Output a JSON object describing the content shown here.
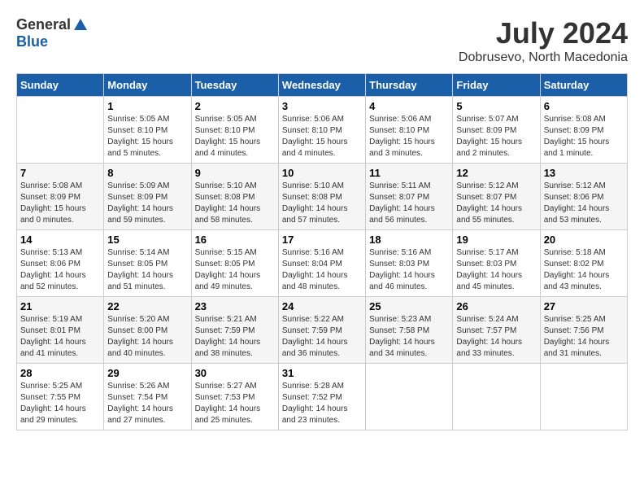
{
  "logo": {
    "general": "General",
    "blue": "Blue"
  },
  "title": {
    "month": "July 2024",
    "location": "Dobrusevo, North Macedonia"
  },
  "headers": [
    "Sunday",
    "Monday",
    "Tuesday",
    "Wednesday",
    "Thursday",
    "Friday",
    "Saturday"
  ],
  "weeks": [
    [
      {
        "day": "",
        "info": ""
      },
      {
        "day": "1",
        "info": "Sunrise: 5:05 AM\nSunset: 8:10 PM\nDaylight: 15 hours\nand 5 minutes."
      },
      {
        "day": "2",
        "info": "Sunrise: 5:05 AM\nSunset: 8:10 PM\nDaylight: 15 hours\nand 4 minutes."
      },
      {
        "day": "3",
        "info": "Sunrise: 5:06 AM\nSunset: 8:10 PM\nDaylight: 15 hours\nand 4 minutes."
      },
      {
        "day": "4",
        "info": "Sunrise: 5:06 AM\nSunset: 8:10 PM\nDaylight: 15 hours\nand 3 minutes."
      },
      {
        "day": "5",
        "info": "Sunrise: 5:07 AM\nSunset: 8:09 PM\nDaylight: 15 hours\nand 2 minutes."
      },
      {
        "day": "6",
        "info": "Sunrise: 5:08 AM\nSunset: 8:09 PM\nDaylight: 15 hours\nand 1 minute."
      }
    ],
    [
      {
        "day": "7",
        "info": "Sunrise: 5:08 AM\nSunset: 8:09 PM\nDaylight: 15 hours\nand 0 minutes."
      },
      {
        "day": "8",
        "info": "Sunrise: 5:09 AM\nSunset: 8:09 PM\nDaylight: 14 hours\nand 59 minutes."
      },
      {
        "day": "9",
        "info": "Sunrise: 5:10 AM\nSunset: 8:08 PM\nDaylight: 14 hours\nand 58 minutes."
      },
      {
        "day": "10",
        "info": "Sunrise: 5:10 AM\nSunset: 8:08 PM\nDaylight: 14 hours\nand 57 minutes."
      },
      {
        "day": "11",
        "info": "Sunrise: 5:11 AM\nSunset: 8:07 PM\nDaylight: 14 hours\nand 56 minutes."
      },
      {
        "day": "12",
        "info": "Sunrise: 5:12 AM\nSunset: 8:07 PM\nDaylight: 14 hours\nand 55 minutes."
      },
      {
        "day": "13",
        "info": "Sunrise: 5:12 AM\nSunset: 8:06 PM\nDaylight: 14 hours\nand 53 minutes."
      }
    ],
    [
      {
        "day": "14",
        "info": "Sunrise: 5:13 AM\nSunset: 8:06 PM\nDaylight: 14 hours\nand 52 minutes."
      },
      {
        "day": "15",
        "info": "Sunrise: 5:14 AM\nSunset: 8:05 PM\nDaylight: 14 hours\nand 51 minutes."
      },
      {
        "day": "16",
        "info": "Sunrise: 5:15 AM\nSunset: 8:05 PM\nDaylight: 14 hours\nand 49 minutes."
      },
      {
        "day": "17",
        "info": "Sunrise: 5:16 AM\nSunset: 8:04 PM\nDaylight: 14 hours\nand 48 minutes."
      },
      {
        "day": "18",
        "info": "Sunrise: 5:16 AM\nSunset: 8:03 PM\nDaylight: 14 hours\nand 46 minutes."
      },
      {
        "day": "19",
        "info": "Sunrise: 5:17 AM\nSunset: 8:03 PM\nDaylight: 14 hours\nand 45 minutes."
      },
      {
        "day": "20",
        "info": "Sunrise: 5:18 AM\nSunset: 8:02 PM\nDaylight: 14 hours\nand 43 minutes."
      }
    ],
    [
      {
        "day": "21",
        "info": "Sunrise: 5:19 AM\nSunset: 8:01 PM\nDaylight: 14 hours\nand 41 minutes."
      },
      {
        "day": "22",
        "info": "Sunrise: 5:20 AM\nSunset: 8:00 PM\nDaylight: 14 hours\nand 40 minutes."
      },
      {
        "day": "23",
        "info": "Sunrise: 5:21 AM\nSunset: 7:59 PM\nDaylight: 14 hours\nand 38 minutes."
      },
      {
        "day": "24",
        "info": "Sunrise: 5:22 AM\nSunset: 7:59 PM\nDaylight: 14 hours\nand 36 minutes."
      },
      {
        "day": "25",
        "info": "Sunrise: 5:23 AM\nSunset: 7:58 PM\nDaylight: 14 hours\nand 34 minutes."
      },
      {
        "day": "26",
        "info": "Sunrise: 5:24 AM\nSunset: 7:57 PM\nDaylight: 14 hours\nand 33 minutes."
      },
      {
        "day": "27",
        "info": "Sunrise: 5:25 AM\nSunset: 7:56 PM\nDaylight: 14 hours\nand 31 minutes."
      }
    ],
    [
      {
        "day": "28",
        "info": "Sunrise: 5:25 AM\nSunset: 7:55 PM\nDaylight: 14 hours\nand 29 minutes."
      },
      {
        "day": "29",
        "info": "Sunrise: 5:26 AM\nSunset: 7:54 PM\nDaylight: 14 hours\nand 27 minutes."
      },
      {
        "day": "30",
        "info": "Sunrise: 5:27 AM\nSunset: 7:53 PM\nDaylight: 14 hours\nand 25 minutes."
      },
      {
        "day": "31",
        "info": "Sunrise: 5:28 AM\nSunset: 7:52 PM\nDaylight: 14 hours\nand 23 minutes."
      },
      {
        "day": "",
        "info": ""
      },
      {
        "day": "",
        "info": ""
      },
      {
        "day": "",
        "info": ""
      }
    ]
  ]
}
